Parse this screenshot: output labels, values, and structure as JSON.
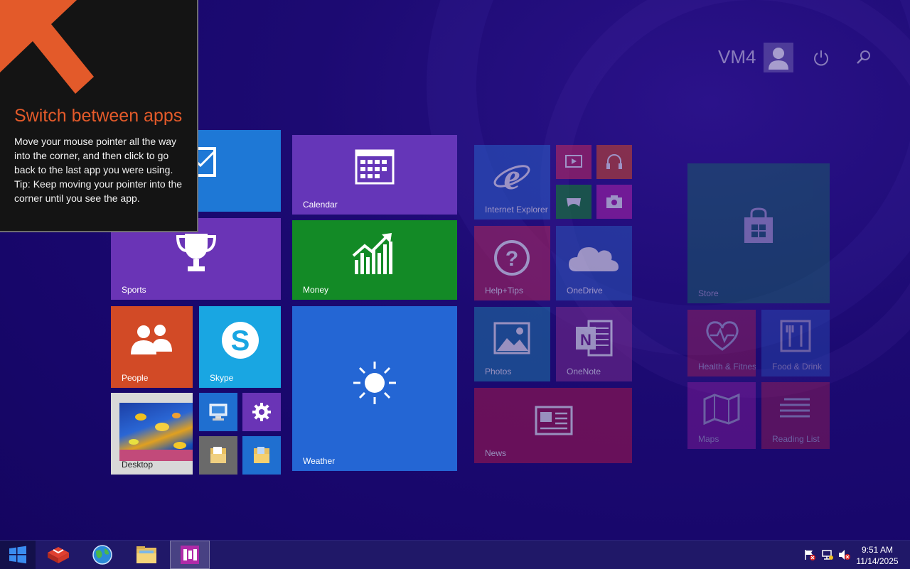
{
  "user": {
    "name": "VM4"
  },
  "tip": {
    "title": "Switch between apps",
    "body": "Move your mouse pointer all the way into the corner, and then click to go back to the last app you were using.\nTip: Keep moving your pointer into the corner until you see the app."
  },
  "tiles": {
    "calendar": "Calendar",
    "sports": "Sports",
    "money": "Money",
    "people": "People",
    "skype": "Skype",
    "weather": "Weather",
    "desktop": "Desktop",
    "ie": "Internet Explorer",
    "help": "Help+Tips",
    "onedrive": "OneDrive",
    "photos": "Photos",
    "onenote": "OneNote",
    "news": "News",
    "store": "Store",
    "health": "Health & Fitness",
    "food": "Food & Drink",
    "maps": "Maps",
    "reading": "Reading List"
  },
  "clock": {
    "time": "9:51 AM",
    "date": "11/14/2025"
  },
  "colors": {
    "background": "#1c0a72",
    "tip_title": "#e35a2a",
    "mail": "#1e78d6",
    "calendar": "#6536b8",
    "sports": "#6a34b6",
    "money": "#138a26",
    "people": "#d24a26",
    "skype": "#19a6e2",
    "weather": "#2466d4",
    "ie": "#2a60c8",
    "help": "#b2275a",
    "onedrive": "#2a55b8",
    "photos": "#1e78a8",
    "onenote": "#7a2c8c",
    "news": "#a8184a"
  }
}
